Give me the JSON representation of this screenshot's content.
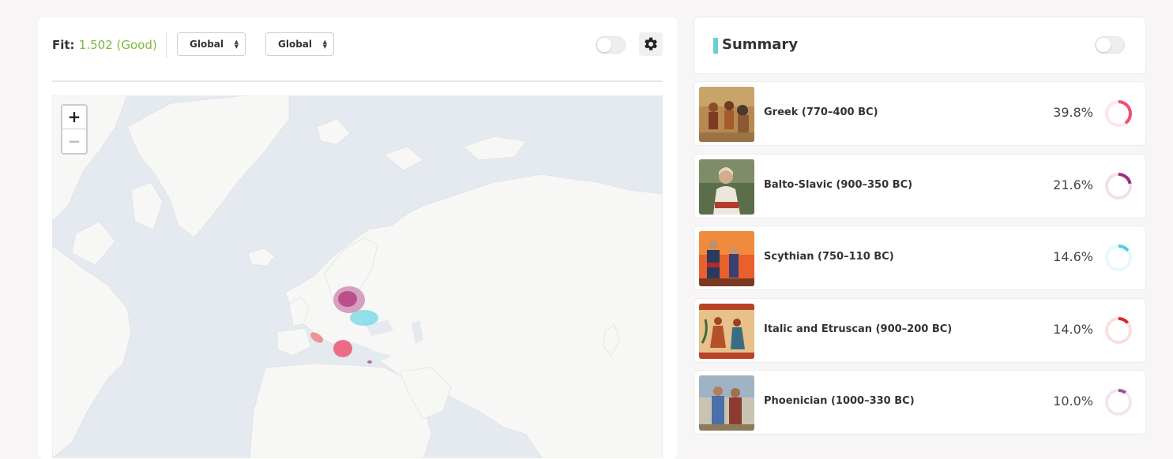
{
  "controls": {
    "fit_label": "Fit:",
    "fit_value": "1.502 (Good)",
    "select_1": "Global",
    "select_2": "Global"
  },
  "summary": {
    "title": "Summary",
    "accent": "#69ced6"
  },
  "populations": [
    {
      "name": "Greek (770–400 BC)",
      "percent": "39.8%",
      "fraction": 0.398,
      "color": "#f0506e",
      "thumb_icon": "warriors-painting"
    },
    {
      "name": "Balto-Slavic (900–350 BC)",
      "percent": "21.6%",
      "fraction": 0.216,
      "color": "#9c2f7c",
      "thumb_icon": "bearded-man-painting"
    },
    {
      "name": "Scythian (750–110 BC)",
      "percent": "14.6%",
      "fraction": 0.146,
      "color": "#4fcfe3",
      "thumb_icon": "horsemen-painting"
    },
    {
      "name": "Italic and Etruscan (900–200 BC)",
      "percent": "14.0%",
      "fraction": 0.14,
      "color": "#d9262e",
      "thumb_icon": "etruscan-fresco"
    },
    {
      "name": "Phoenician (1000–330 BC)",
      "percent": "10.0%",
      "fraction": 0.1,
      "color": "#a04f9a",
      "thumb_icon": "traders-painting"
    }
  ]
}
